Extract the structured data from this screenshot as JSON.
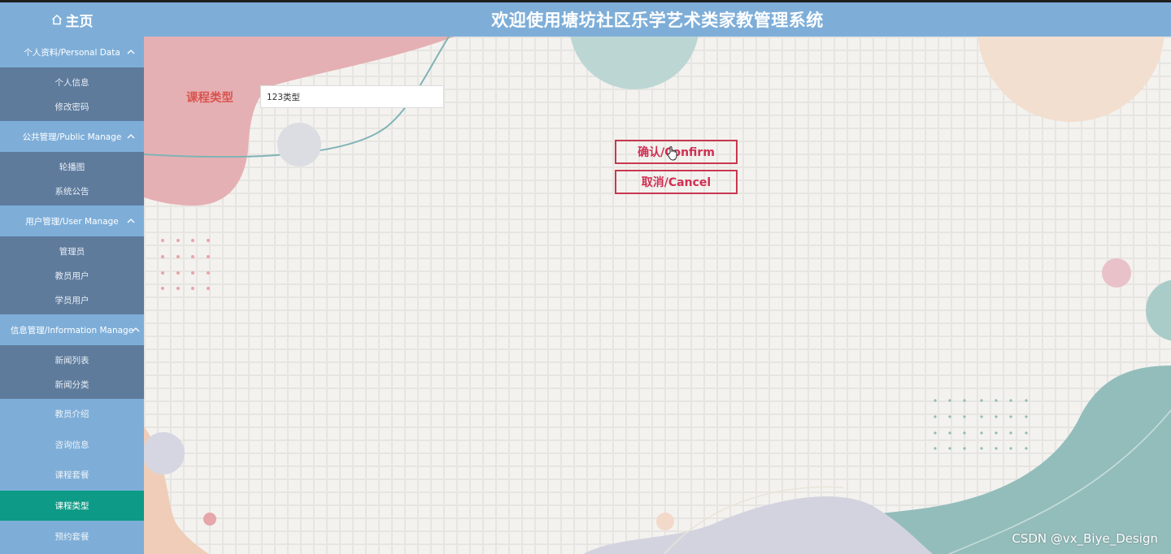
{
  "header": {
    "home_label": "主页",
    "title": "欢迎使用塘坊社区乐学艺术类家教管理系统"
  },
  "sidebar": {
    "groups": [
      {
        "label": "个人资料/Personal Data",
        "items": [
          "个人信息",
          "修改密码"
        ]
      },
      {
        "label": "公共管理/Public Manage",
        "items": [
          "轮播图",
          "系统公告"
        ]
      },
      {
        "label": "用户管理/User Manage",
        "items": [
          "管理员",
          "教员用户",
          "学员用户"
        ]
      },
      {
        "label": "信息管理/Information Manage",
        "items": [
          "新闻列表",
          "新闻分类"
        ]
      }
    ],
    "plain_items": [
      "教员介绍",
      "咨询信息",
      "课程套餐",
      "课程类型",
      "预约套餐"
    ],
    "active_item": "课程类型"
  },
  "form": {
    "field_label": "课程类型",
    "field_value": "123类型"
  },
  "buttons": {
    "confirm_label": "确认/Confirm",
    "cancel_label": "取消/Cancel"
  },
  "watermark": "CSDN @vx_Biye_Design",
  "colors": {
    "header_bg": "#7eaed8",
    "submenu_bg": "#5e7b9c",
    "active_bg": "#0d9a86",
    "accent_red": "#d12f52",
    "label_red": "#d9544f"
  },
  "icons": {
    "home": "home-icon",
    "chevron": "chevron-up-icon",
    "cursor": "hand-cursor-icon"
  }
}
